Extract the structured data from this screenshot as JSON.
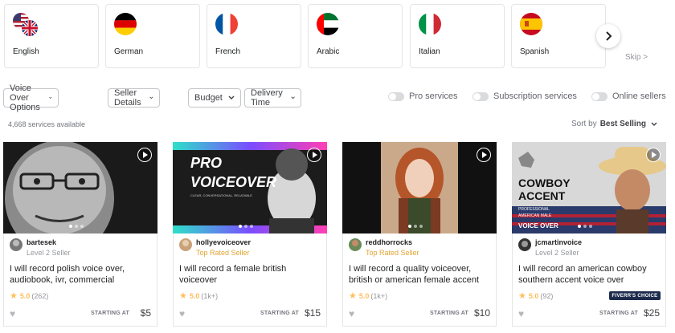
{
  "languages": [
    {
      "label": "English",
      "flag": "us-uk-flag-icon"
    },
    {
      "label": "German",
      "flag": "germany-flag-icon"
    },
    {
      "label": "French",
      "flag": "france-flag-icon"
    },
    {
      "label": "Arabic",
      "flag": "uae-flag-icon"
    },
    {
      "label": "Italian",
      "flag": "italy-flag-icon"
    },
    {
      "label": "Spanish",
      "flag": "spain-flag-icon"
    }
  ],
  "skip_label": "Skip >",
  "filters": [
    {
      "label": "Voice Over Options"
    },
    {
      "label": "Seller Details"
    },
    {
      "label": "Budget"
    },
    {
      "label": "Delivery Time"
    }
  ],
  "toggles": [
    {
      "label": "Pro services",
      "on": false
    },
    {
      "label": "Subscription services",
      "on": false
    },
    {
      "label": "Online sellers",
      "on": false
    }
  ],
  "results": {
    "count": "4,668 services available",
    "sort_prefix": "Sort by",
    "sort_value": "Best Selling"
  },
  "gigs": [
    {
      "seller": "bartesek",
      "level": "Level 2 Seller",
      "title": "I will record polish voice over, audiobook, ivr, commercial",
      "rating": "5.0",
      "reviews": "(262)",
      "starting": "STARTING AT",
      "price": "$5"
    },
    {
      "seller": "hollyevoiceover",
      "level": "Top Rated Seller",
      "title": "I will record a female british voiceover",
      "rating": "5.0",
      "reviews": "(1k+)",
      "starting": "STARTING AT",
      "price": "$15",
      "thumb_text": {
        "line1": "PRO",
        "line2": "VOICEOVER",
        "line3": "CLEAR, CONVERSATIONAL, RELATABLE"
      }
    },
    {
      "seller": "reddhorrocks",
      "level": "Top Rated Seller",
      "title": "I will record a quality voiceover, british or american female accent",
      "rating": "5.0",
      "reviews": "(1k+)",
      "starting": "STARTING AT",
      "price": "$10"
    },
    {
      "seller": "jcmartinvoice",
      "level": "Level 2 Seller",
      "title": "I will record an american cowboy southern accent voice over",
      "rating": "5.0",
      "reviews": "(92)",
      "starting": "STARTING AT",
      "price": "$25",
      "badge": "FIVERR'S CHOICE",
      "thumb_text": {
        "line1": "COWBOY",
        "line2": "ACCENT",
        "line3": "PROFESSIONAL",
        "line4": "AMERICAN MALE",
        "line5": "VOICE OVER"
      }
    }
  ],
  "colors": {
    "star": "#ffbe5b",
    "top_rated": "#e0a533",
    "choice_bg": "#1d2c4c"
  }
}
